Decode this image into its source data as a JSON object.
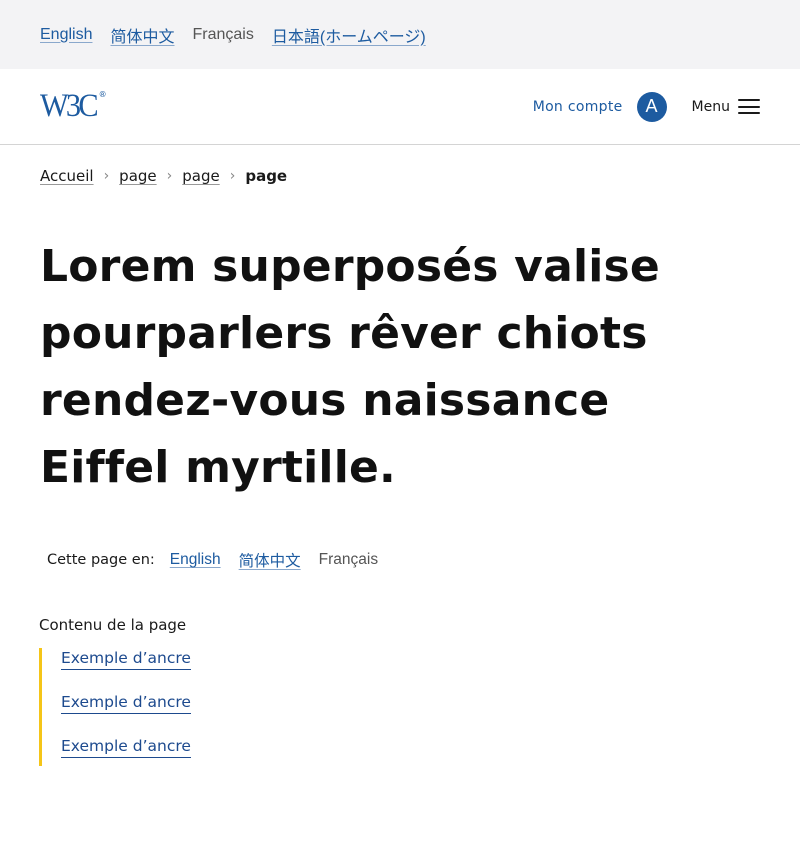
{
  "language_bar": {
    "items": [
      {
        "label": "English",
        "current": false
      },
      {
        "label": "简体中文",
        "current": false
      },
      {
        "label": "Français",
        "current": true
      },
      {
        "label": "日本語(ホームページ)",
        "current": false
      }
    ]
  },
  "header": {
    "logo_text": "W3C",
    "logo_mark": "®",
    "account_label": "Mon compte",
    "avatar_initial": "A",
    "menu_label": "Menu",
    "menu_icon": "hamburger-icon"
  },
  "breadcrumb": {
    "items": [
      "Accueil",
      "page",
      "page"
    ],
    "separator": "›",
    "current": "page"
  },
  "page_title": "Lorem superposés valise pourparlers rêver chiots rendez-vous naissance Eiffel myrtille.",
  "page_languages": {
    "label": "Cette page en:",
    "items": [
      {
        "label": "English",
        "current": false
      },
      {
        "label": "简体中文",
        "current": false
      },
      {
        "label": "Français",
        "current": true
      }
    ]
  },
  "toc": {
    "title": "Contenu de la page",
    "items": [
      "Exemple d’ancre",
      "Exemple d’ancre",
      "Exemple d’ancre"
    ]
  },
  "colors": {
    "brand_blue": "#1d5ba0",
    "toc_accent": "#f5c518",
    "lang_bar_bg": "#f3f3f5"
  }
}
